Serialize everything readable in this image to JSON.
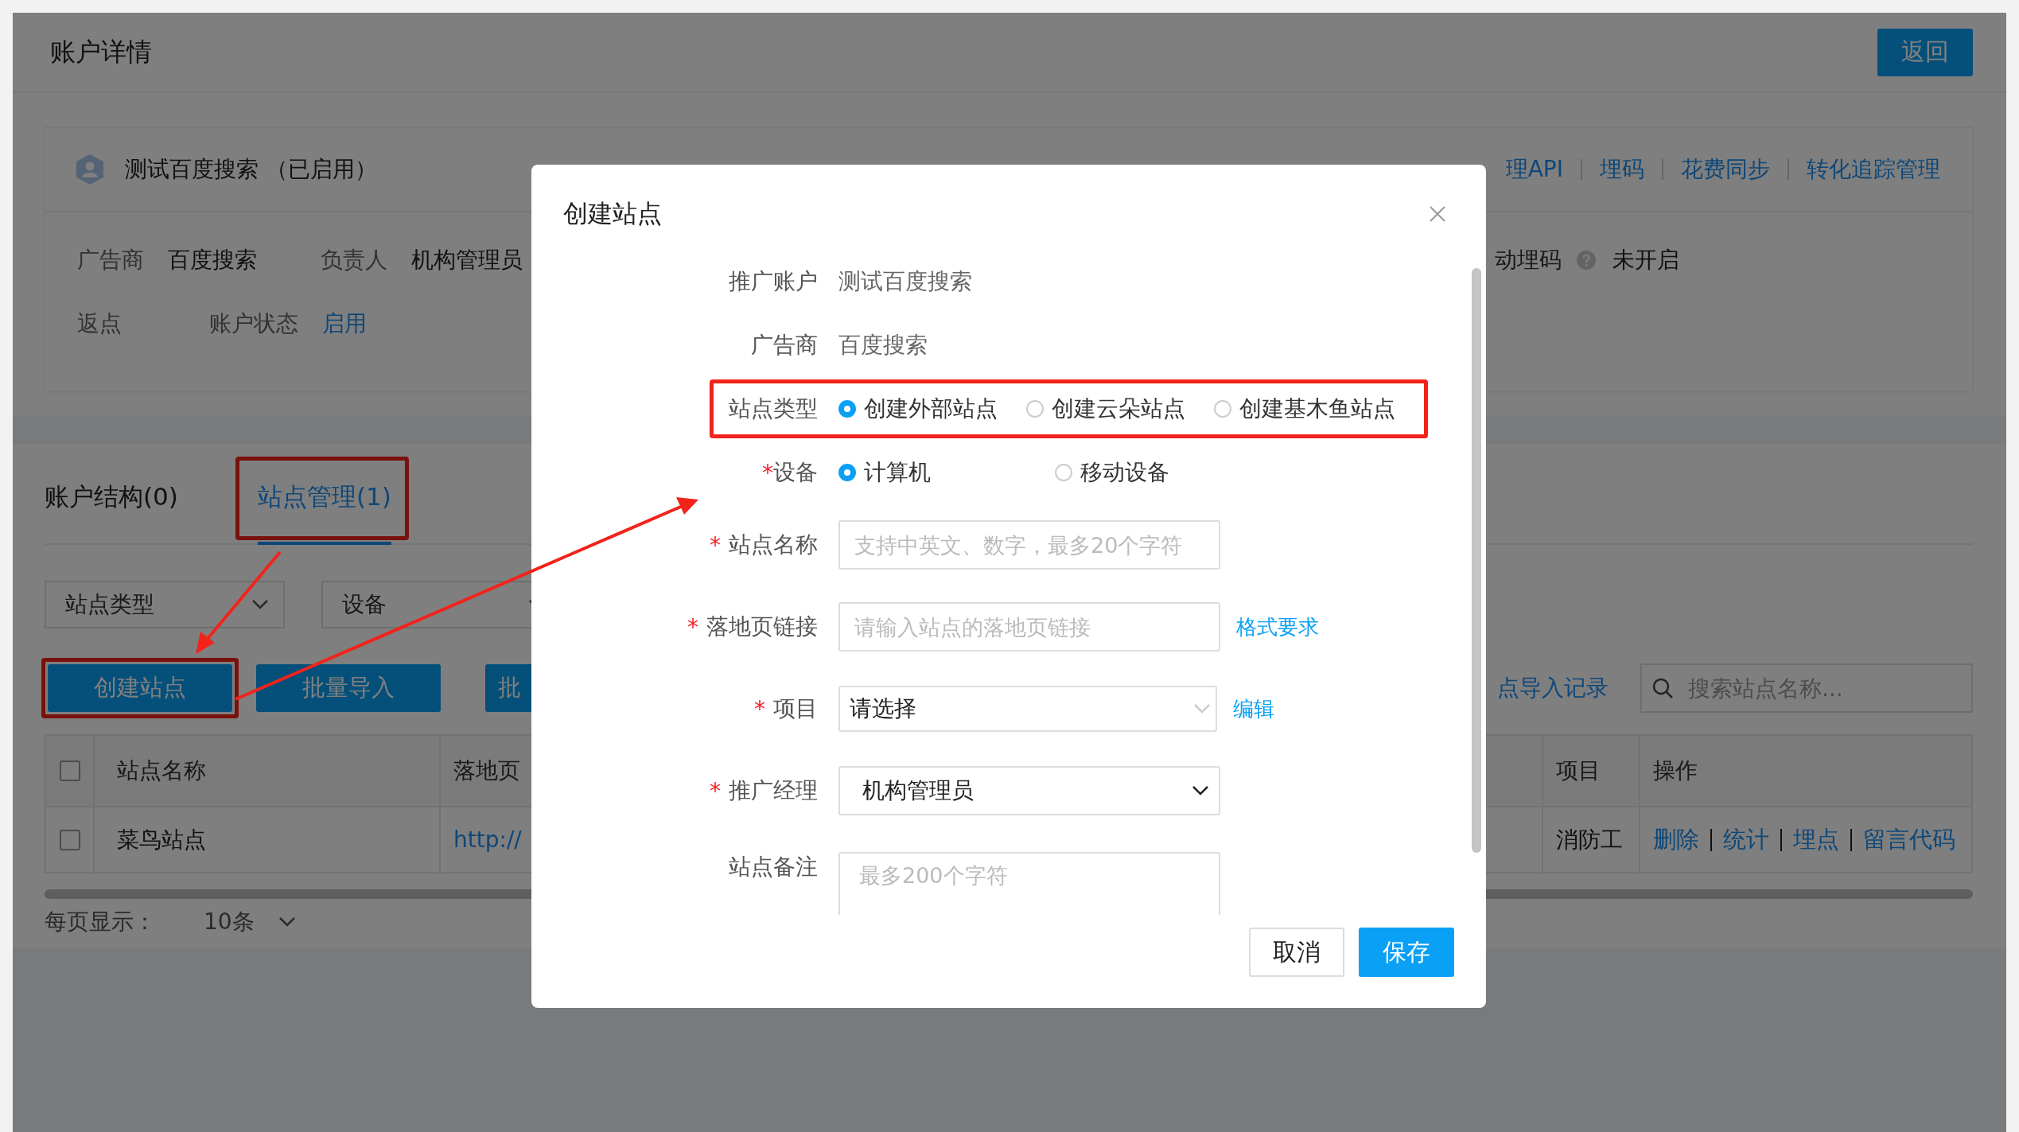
{
  "header": {
    "title": "账户详情",
    "back_button": "返回"
  },
  "account": {
    "name": "测试百度搜索 （已启用）",
    "links": [
      "理API",
      "埋码",
      "花费同步",
      "转化追踪管理"
    ],
    "rows": [
      [
        {
          "label": "广告商",
          "value": "百度搜索",
          "kind": "text"
        },
        {
          "label": "负责人",
          "value": "机构管理员",
          "kind": "text"
        }
      ],
      [
        {
          "label": "返点"
        },
        {
          "label": "账户状态",
          "value": "启用",
          "kind": "status"
        }
      ]
    ],
    "auto_code": {
      "label": "动埋码",
      "value": "未开启"
    }
  },
  "tabs": [
    {
      "label": "账户结构(0)",
      "selected": false,
      "highlighted": false
    },
    {
      "label": "站点管理(1)",
      "selected": true,
      "highlighted": true
    }
  ],
  "filters": [
    {
      "label": "站点类型"
    },
    {
      "label": "设备"
    }
  ],
  "actions": [
    {
      "label": "创建站点",
      "highlighted": true
    },
    {
      "label": "批量导入",
      "highlighted": false
    },
    {
      "label": "批",
      "highlighted": false
    }
  ],
  "import_log_link": "点导入记录",
  "search": {
    "placeholder": "搜索站点名称..."
  },
  "table": {
    "columns": [
      "站点名称",
      "落地页",
      "项目",
      "操作"
    ],
    "header_checked": false,
    "rows": [
      {
        "checked": false,
        "cells": [
          "菜鸟站点",
          "http://",
          "消防工"
        ],
        "actions": [
          "删除",
          "统计",
          "埋点",
          "留言代码"
        ]
      }
    ]
  },
  "pagination": {
    "label": "每页显示：",
    "page_size": "10条"
  },
  "dialog": {
    "title": "创建站点",
    "fields": [
      {
        "kind": "static",
        "label": "推广账户",
        "value": "测试百度搜索",
        "highlighted": false
      },
      {
        "kind": "static",
        "label": "广告商",
        "value": "百度搜索",
        "highlighted": false
      },
      {
        "kind": "radio",
        "label": "站点类型",
        "highlighted": true,
        "options": [
          {
            "label": "创建外部站点",
            "selected": true
          },
          {
            "label": "创建云朵站点",
            "selected": false
          },
          {
            "label": "创建基木鱼站点",
            "selected": false
          }
        ]
      },
      {
        "kind": "radio",
        "label": "设备",
        "mark": "*",
        "tight": true,
        "highlighted": false,
        "options": [
          {
            "label": "计算机",
            "selected": true
          },
          {
            "label": "移动设备",
            "selected": false
          }
        ]
      },
      {
        "kind": "input",
        "label": "站点名称",
        "mark": "*",
        "placeholder": "支持中英文、数字，最多20个字符",
        "highlighted": false
      },
      {
        "kind": "input",
        "label": "落地页链接",
        "mark": "*",
        "placeholder": "请输入站点的落地页链接",
        "link": "格式要求",
        "highlighted": false
      },
      {
        "kind": "select",
        "label": "项目",
        "mark": "*",
        "value": "请选择",
        "link": "编辑",
        "highlighted": false
      },
      {
        "kind": "dropdown",
        "label": "推广经理",
        "mark": "*",
        "value": "机构管理员",
        "highlighted": false
      },
      {
        "kind": "textarea",
        "label": "站点备注",
        "placeholder": "最多200个字符",
        "highlighted": false
      }
    ],
    "buttons": [
      {
        "label": "取消",
        "kind": "default"
      },
      {
        "label": "保存",
        "kind": "primary"
      }
    ]
  }
}
